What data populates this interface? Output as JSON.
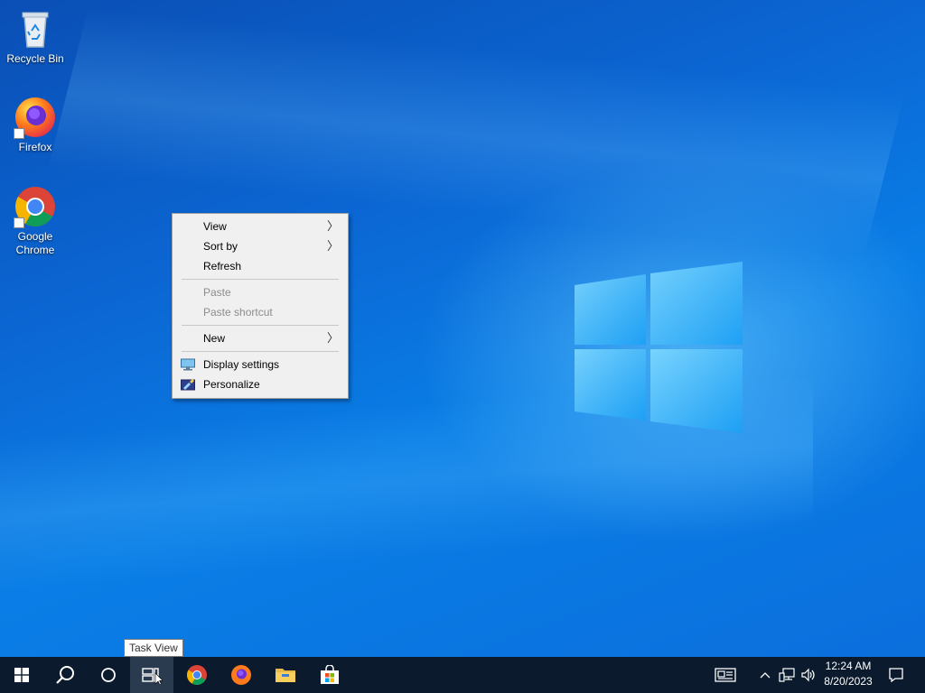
{
  "desktop": {
    "icons": [
      {
        "label": "Recycle Bin",
        "icon": "recycle-bin-icon"
      },
      {
        "label": "Firefox",
        "icon": "firefox-icon"
      },
      {
        "label": "Google Chrome",
        "icon": "chrome-icon"
      }
    ]
  },
  "context_menu": {
    "items": [
      {
        "label": "View",
        "submenu": true,
        "enabled": true
      },
      {
        "label": "Sort by",
        "submenu": true,
        "enabled": true
      },
      {
        "label": "Refresh",
        "submenu": false,
        "enabled": true
      },
      {
        "label": "Paste",
        "submenu": false,
        "enabled": false
      },
      {
        "label": "Paste shortcut",
        "submenu": false,
        "enabled": false
      },
      {
        "label": "New",
        "submenu": true,
        "enabled": true
      },
      {
        "label": "Display settings",
        "submenu": false,
        "enabled": true,
        "icon": "display-settings-icon"
      },
      {
        "label": "Personalize",
        "submenu": false,
        "enabled": true,
        "icon": "personalize-icon"
      }
    ],
    "arrow_glyph": "〉"
  },
  "tooltip": {
    "text": "Task View"
  },
  "taskbar": {
    "buttons": [
      "start-icon",
      "search-icon",
      "cortana-icon",
      "task-view-icon",
      "chrome-icon",
      "firefox-icon",
      "file-explorer-icon",
      "store-icon"
    ],
    "tray": {
      "time": "12:24 AM",
      "date": "8/20/2023",
      "icons": [
        "news-icon",
        "chevron-up-icon",
        "network-icon",
        "volume-icon",
        "notification-icon"
      ]
    }
  },
  "colors": {
    "taskbar": "#0b1a2c",
    "menu_bg": "#f0f0f0",
    "disabled_text": "#8c8c8c",
    "desktop_blue": "#0b67d4"
  }
}
